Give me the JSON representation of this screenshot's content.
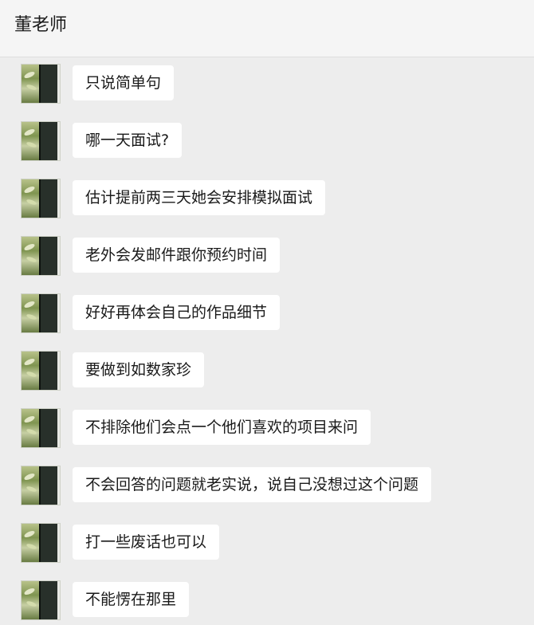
{
  "chat": {
    "title": "董老师",
    "messages": [
      {
        "text": "只说简单句"
      },
      {
        "text": "哪一天面试?"
      },
      {
        "text": "估计提前两三天她会安排模拟面试"
      },
      {
        "text": "老外会发邮件跟你预约时间"
      },
      {
        "text": "好好再体会自己的作品细节"
      },
      {
        "text": "要做到如数家珍"
      },
      {
        "text": "不排除他们会点一个他们喜欢的项目来问"
      },
      {
        "text": "不会回答的问题就老实说，说自己没想过这个问题"
      },
      {
        "text": "打一些废话也可以"
      },
      {
        "text": "不能愣在那里"
      }
    ]
  }
}
